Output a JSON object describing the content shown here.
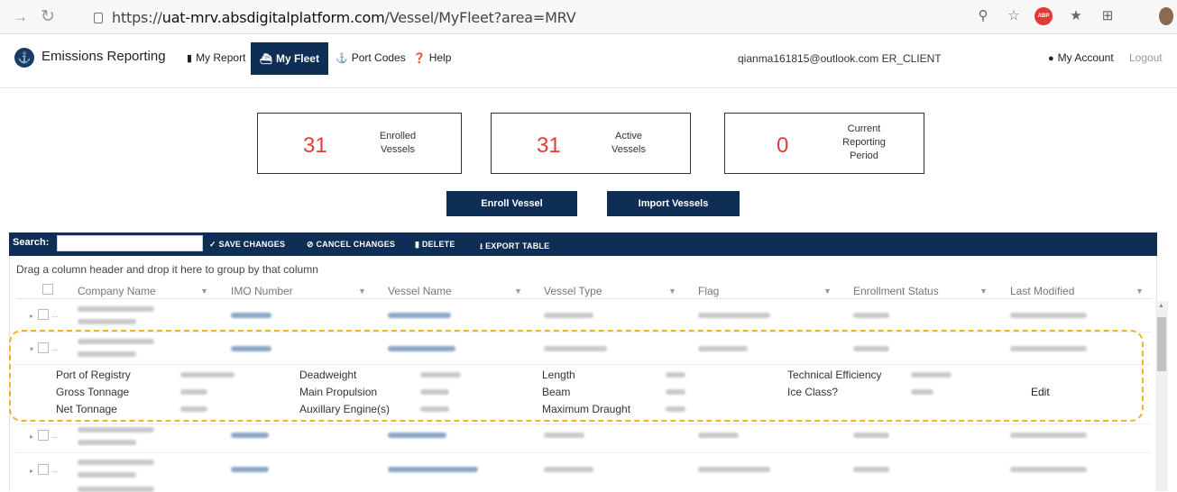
{
  "browser": {
    "url_prefix": "https://",
    "url_host": "uat-mrv.absdigitalplatform.com",
    "url_path": "/Vessel/MyFleet?area=MRV",
    "icons": [
      "back-icon",
      "refresh-icon",
      "lock-icon",
      "zoom-icon",
      "tracking-icon",
      "adblock-icon",
      "favorites-icon",
      "collections-icon",
      "profile-avatar"
    ],
    "adblock_label": "ABP"
  },
  "nav": {
    "brand": "Emissions Reporting",
    "items": [
      {
        "label": "My Report"
      },
      {
        "label": "My Fleet"
      },
      {
        "label": "Port Codes"
      },
      {
        "label": "Help"
      }
    ],
    "user": "qianma161815@outlook.com ER_CLIENT",
    "account": "My Account",
    "logout": "Logout"
  },
  "stats": [
    {
      "value": "31",
      "line1": "Enrolled",
      "line2": "Vessels",
      "line3": ""
    },
    {
      "value": "31",
      "line1": "Active",
      "line2": "Vessels",
      "line3": ""
    },
    {
      "value": "0",
      "line1": "Current",
      "line2": "Reporting",
      "line3": "Period"
    }
  ],
  "buttons": {
    "enroll": "Enroll Vessel",
    "import": "Import Vessels"
  },
  "toolbar": {
    "search_label": "Search:",
    "save": "SAVE CHANGES",
    "cancel": "CANCEL CHANGES",
    "delete": "DELETE",
    "export": "EXPORT TABLE"
  },
  "grid": {
    "group_hint": "Drag a column header and drop it here to group by that column",
    "columns": [
      "Company Name",
      "IMO Number",
      "Vessel Name",
      "Vessel Type",
      "Flag",
      "Enrollment Status",
      "Last Modified"
    ],
    "detail": {
      "labels": [
        "Port of Registry",
        "Gross Tonnage",
        "Net Tonnage",
        "Deadweight",
        "Main Propulsion",
        "Auxillary Engine(s)",
        "Length",
        "Beam",
        "Maximum Draught",
        "Technical Efficiency",
        "Ice Class?"
      ],
      "edit": "Edit"
    },
    "row_expand_glyph": "▸",
    "row_collapse_glyph": "▾",
    "dots": "..."
  },
  "colors": {
    "navy": "#0f2e55",
    "stat_number": "#e53935",
    "highlight": "#f0b429"
  }
}
